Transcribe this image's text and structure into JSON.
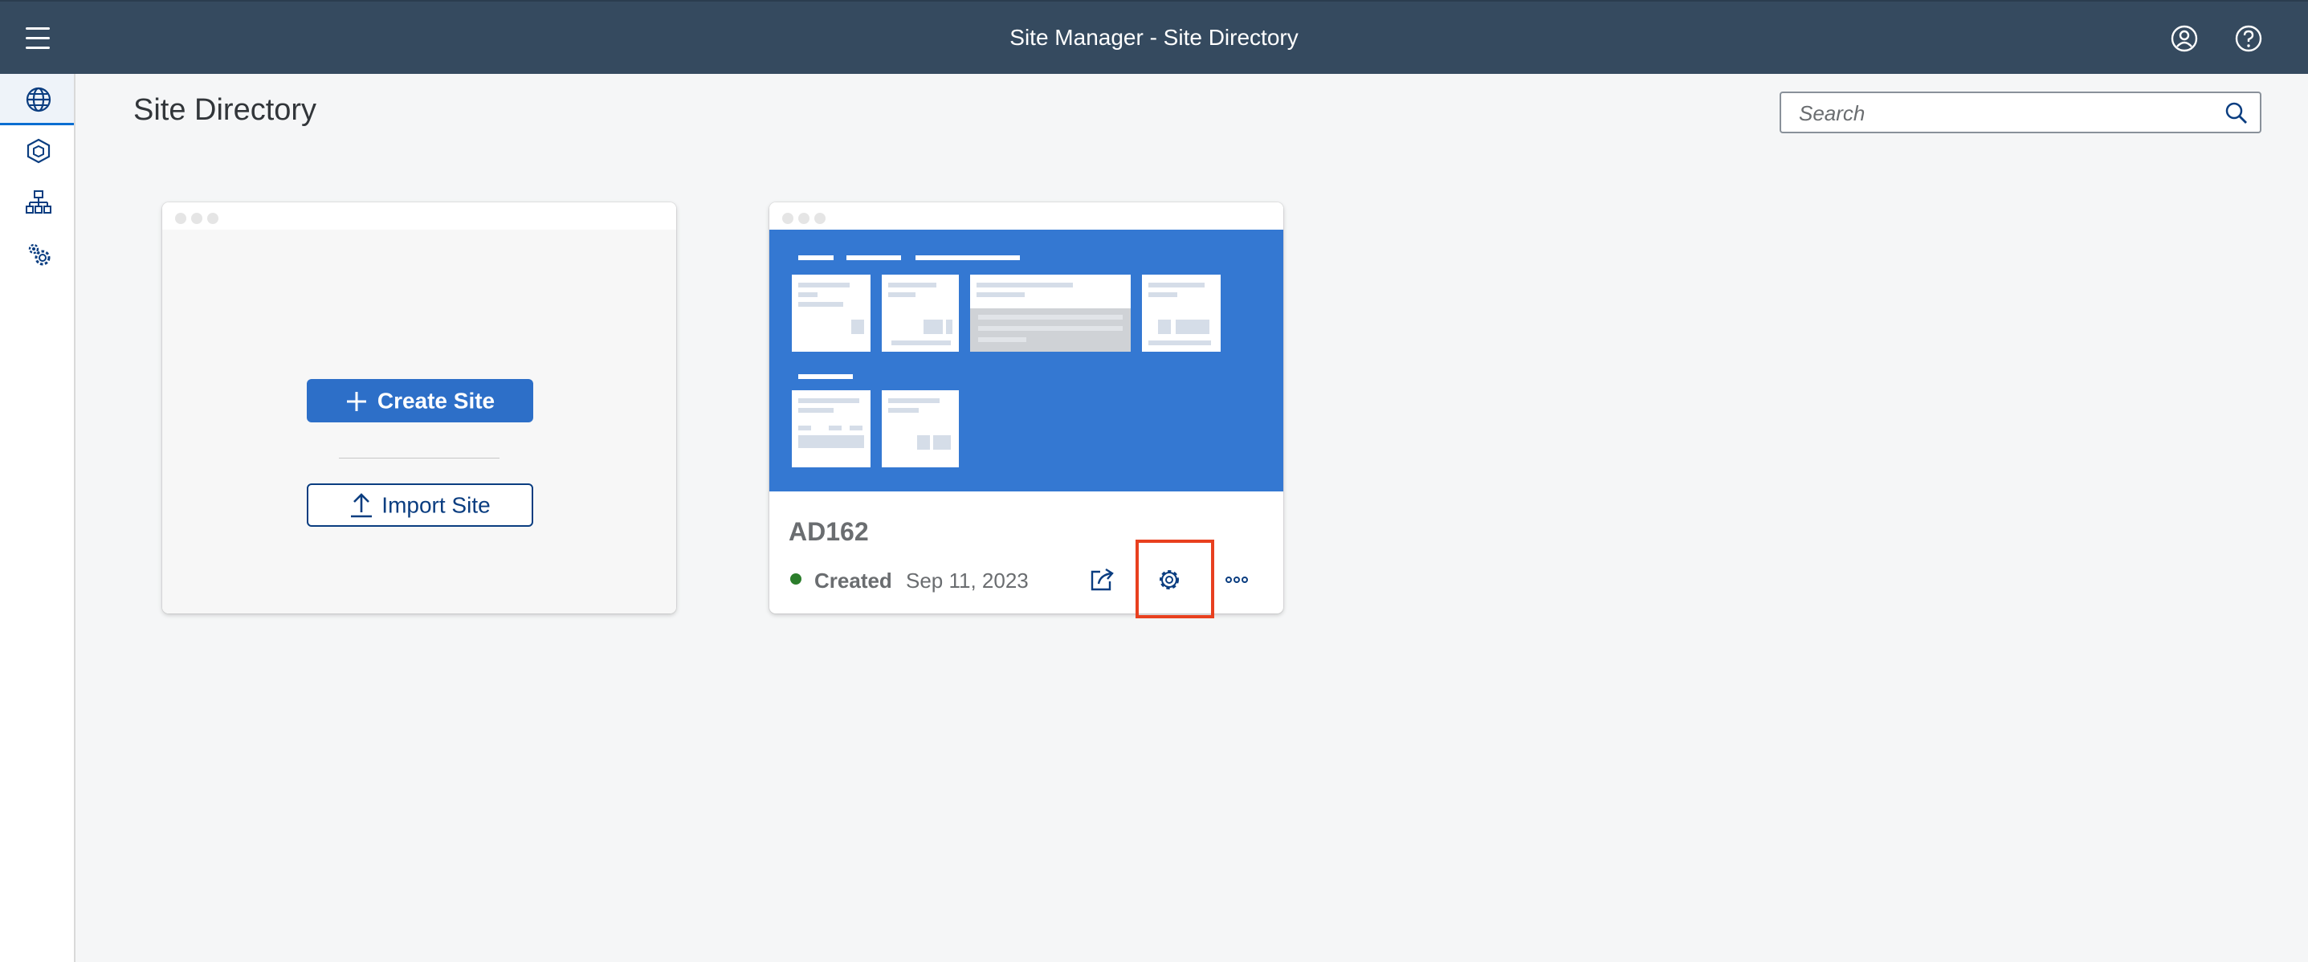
{
  "shell": {
    "title": "Site Manager - Site Directory"
  },
  "page": {
    "title": "Site Directory"
  },
  "search": {
    "placeholder": "Search"
  },
  "create_card": {
    "create_label": "Create Site",
    "import_label": "Import Site"
  },
  "site": {
    "name": "AD162",
    "status": "Created",
    "date": "Sep 11, 2023",
    "status_color": "#2b7d2b"
  },
  "colors": {
    "shell": "#354a5f",
    "accent": "#2d6fc8",
    "preview": "#3478d2",
    "highlight": "#e8401f"
  },
  "icons": [
    "menu-icon",
    "user-icon",
    "help-icon",
    "globe-icon",
    "cube-icon",
    "sitemap-icon",
    "settings-icon",
    "search-icon",
    "plus-icon",
    "upload-icon",
    "share-icon",
    "gear-icon",
    "overflow-icon"
  ]
}
